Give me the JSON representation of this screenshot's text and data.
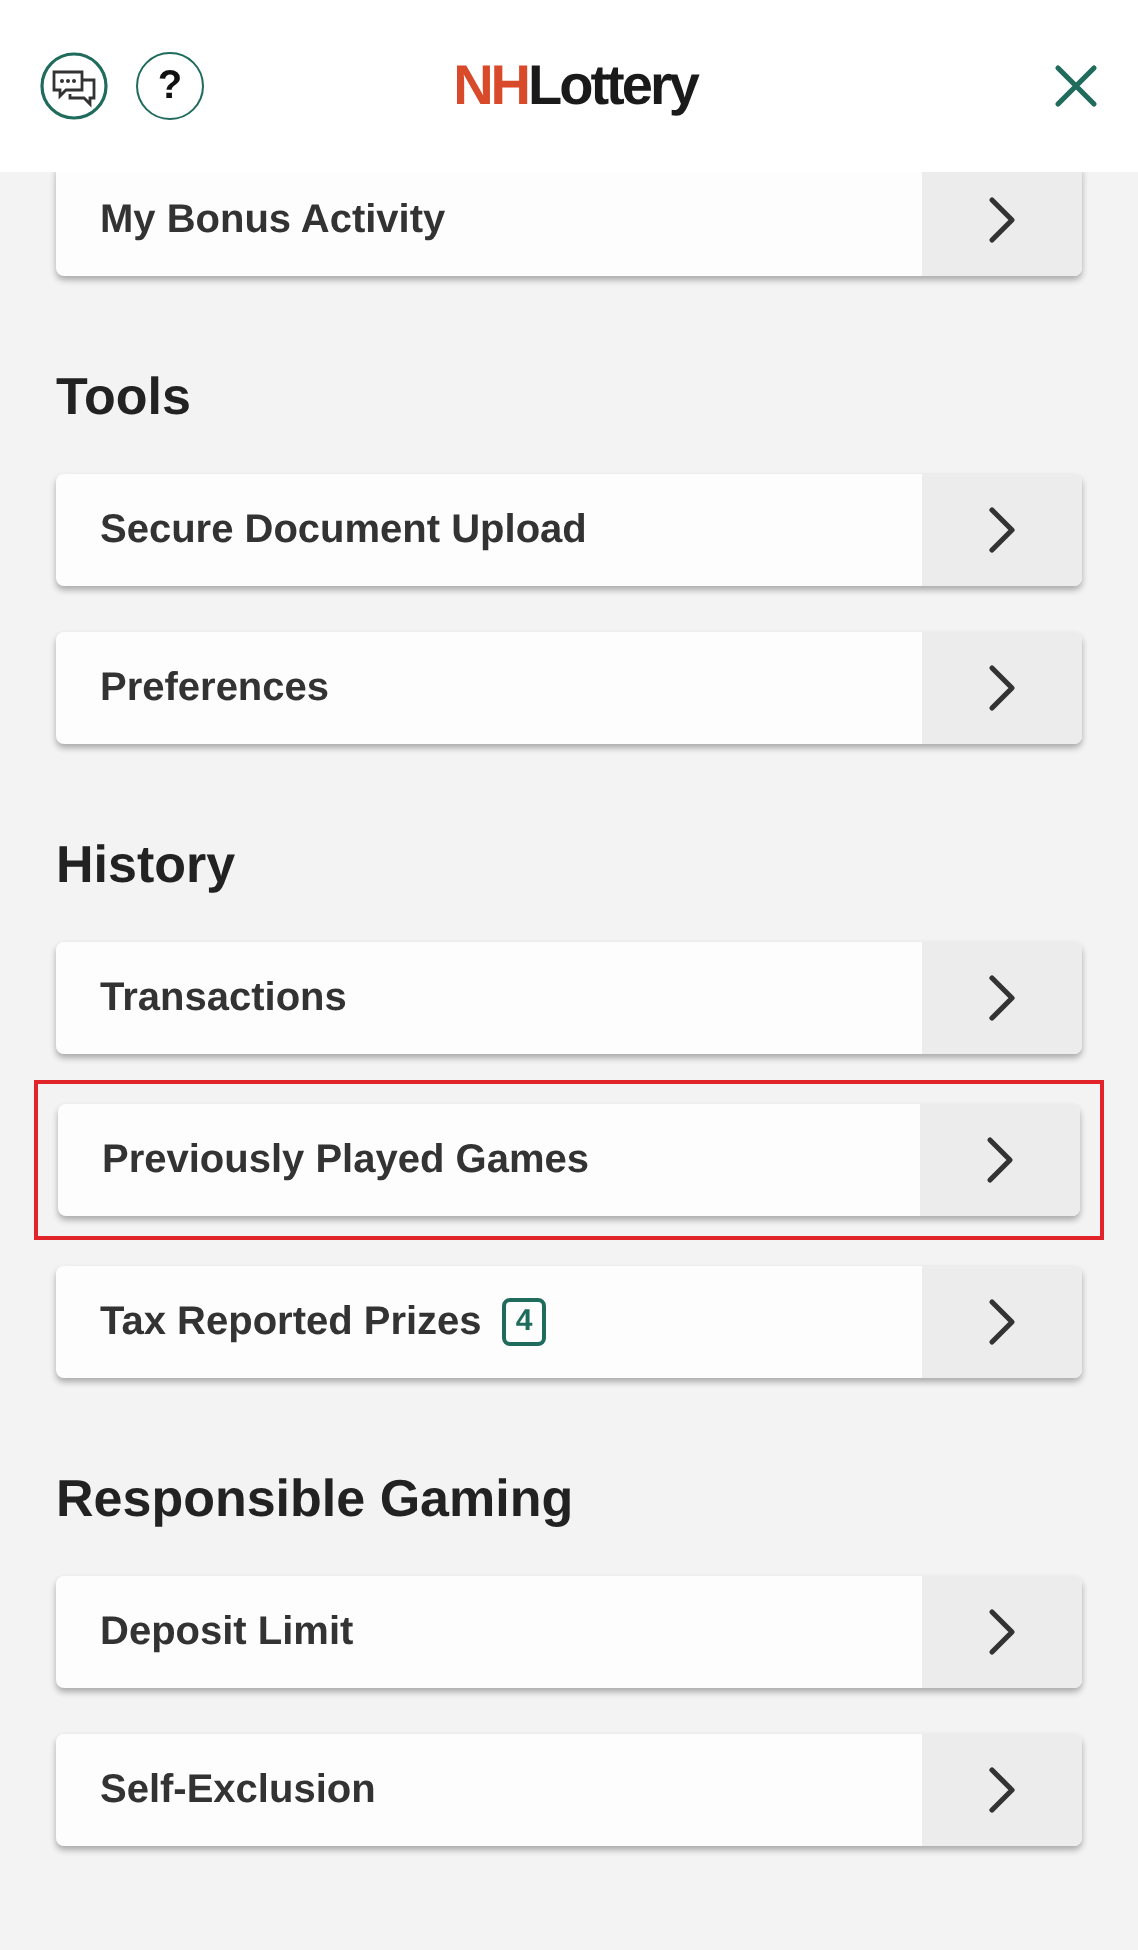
{
  "header": {
    "logo": {
      "part_1": "NH",
      "part_2": "Lottery"
    },
    "help_label": "?"
  },
  "sections": [
    {
      "items": [
        {
          "label": "My Bonus Activity",
          "highlighted": false
        }
      ]
    },
    {
      "title": "Tools",
      "items": [
        {
          "label": "Secure Document Upload",
          "highlighted": false
        },
        {
          "label": "Preferences",
          "highlighted": false
        }
      ]
    },
    {
      "title": "History",
      "items": [
        {
          "label": "Transactions",
          "highlighted": false
        },
        {
          "label": "Previously Played Games",
          "highlighted": true
        },
        {
          "label": "Tax Reported Prizes",
          "badge": "4",
          "highlighted": false
        }
      ]
    },
    {
      "title": "Responsible Gaming",
      "items": [
        {
          "label": "Deposit Limit",
          "highlighted": false
        },
        {
          "label": "Self-Exclusion",
          "highlighted": false
        }
      ]
    }
  ]
}
